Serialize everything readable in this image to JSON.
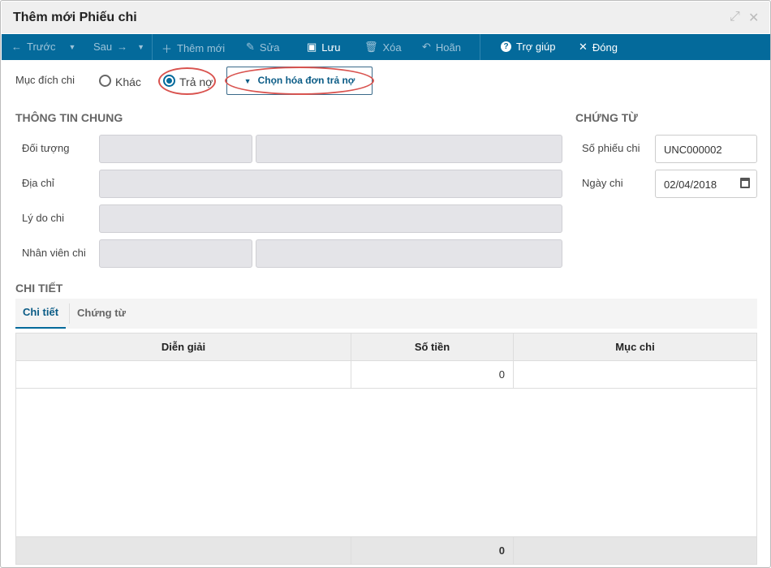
{
  "window": {
    "title": "Thêm mới Phiếu chi"
  },
  "toolbar": {
    "prev": "Trước",
    "next": "Sau",
    "add": "Thêm mới",
    "edit": "Sửa",
    "save": "Lưu",
    "delete": "Xóa",
    "undo": "Hoãn",
    "help": "Trợ giúp",
    "close": "Đóng"
  },
  "purpose": {
    "label": "Mục đích chi",
    "option_other": "Khác",
    "option_debt": "Trả nợ",
    "selected": "Trả nợ",
    "choose_invoice": "Chọn hóa đơn trả nợ"
  },
  "general": {
    "title": "THÔNG TIN CHUNG",
    "object": "Đối tượng",
    "address": "Địa chỉ",
    "reason": "Lý do chi",
    "employee": "Nhân viên chi"
  },
  "voucher": {
    "title": "CHỨNG TỪ",
    "number_label": "Số phiếu chi",
    "number": "UNC000002",
    "date_label": "Ngày chi",
    "date": "02/04/2018"
  },
  "detail": {
    "title": "CHI TIẾT",
    "tabs": [
      "Chi tiết",
      "Chứng từ"
    ],
    "columns": [
      "Diễn giải",
      "Số tiền",
      "Mục chi"
    ],
    "rows": [
      {
        "desc": "",
        "amount": "0",
        "category": ""
      }
    ],
    "total": "0"
  }
}
